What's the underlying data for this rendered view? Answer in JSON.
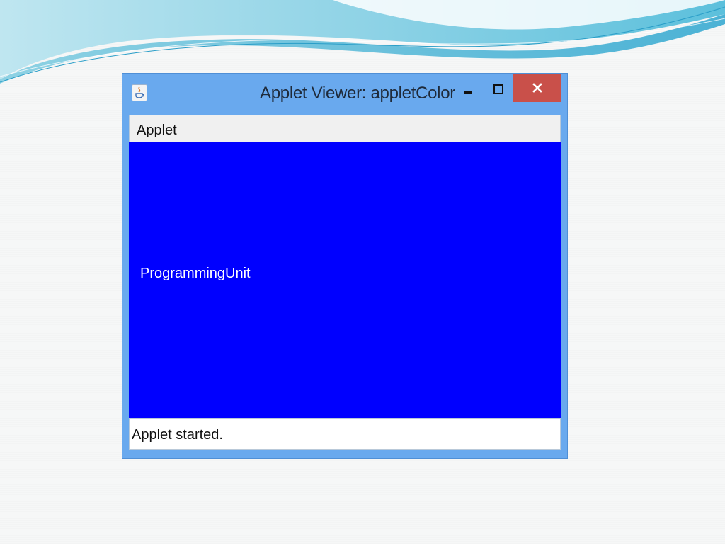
{
  "window": {
    "title": "Applet Viewer: appletColor"
  },
  "menu": {
    "items": [
      {
        "label": "Applet"
      }
    ]
  },
  "applet": {
    "text": "ProgrammingUnit",
    "background_color": "#0000ff",
    "text_color": "#ffffff"
  },
  "status": {
    "text": "Applet started."
  },
  "icons": {
    "app": "java-cup-icon",
    "minimize": "minimize-icon",
    "maximize": "maximize-icon",
    "close": "close-icon"
  },
  "colors": {
    "window_frame": "#69a9ee",
    "close_button": "#c9504a",
    "menubar": "#f0f0f0"
  }
}
